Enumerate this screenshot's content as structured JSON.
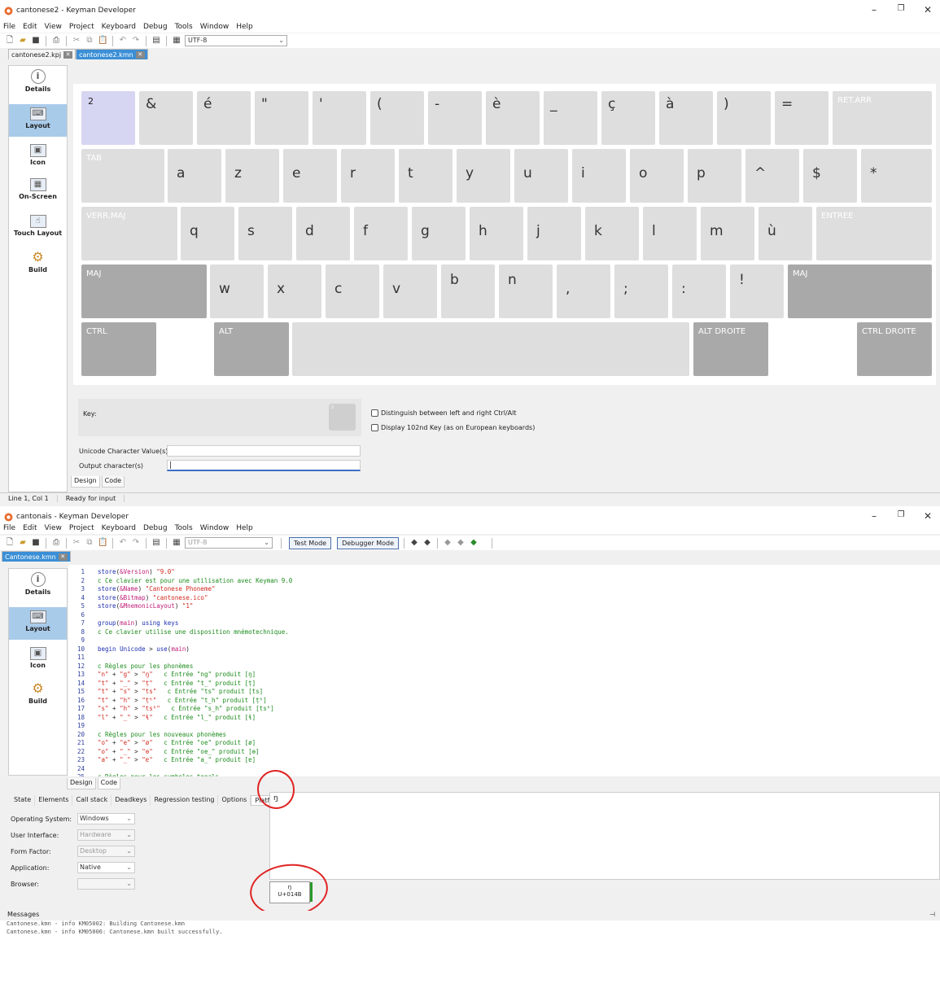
{
  "window1": {
    "title": "cantonese2 - Keyman Developer",
    "menu": [
      "File",
      "Edit",
      "View",
      "Project",
      "Keyboard",
      "Debug",
      "Tools",
      "Window",
      "Help"
    ],
    "encoding": "UTF-8",
    "tabs": [
      {
        "label": "cantonese2.kpj",
        "active": false
      },
      {
        "label": "cantonese2.kmn",
        "active": true
      }
    ],
    "sidebar": [
      {
        "label": "Details",
        "icon": "info-icon",
        "active": false
      },
      {
        "label": "Layout",
        "icon": "keyboard-icon",
        "active": true
      },
      {
        "label": "Icon",
        "icon": "image-icon",
        "active": false
      },
      {
        "label": "On-Screen",
        "icon": "screen-keyboard-icon",
        "active": false
      },
      {
        "label": "Touch Layout",
        "icon": "touch-icon",
        "active": false
      },
      {
        "label": "Build",
        "icon": "gear-icon",
        "active": false
      }
    ],
    "keyboard": {
      "row1": [
        "2",
        "&",
        "é",
        "\"",
        "'",
        "(",
        "-",
        "è",
        "_",
        "ç",
        "à",
        ")",
        "=",
        "RET.ARR"
      ],
      "row2": [
        "TAB",
        "a",
        "z",
        "e",
        "r",
        "t",
        "y",
        "u",
        "i",
        "o",
        "p",
        "^",
        "$",
        "*"
      ],
      "row3": [
        "VERR.MAJ",
        "q",
        "s",
        "d",
        "f",
        "g",
        "h",
        "j",
        "k",
        "l",
        "m",
        "ù",
        "ENTREE"
      ],
      "row4": [
        "MAJ",
        "w",
        "x",
        "c",
        "v",
        "b",
        "n",
        ",",
        ";",
        ":",
        "!",
        "MAJ"
      ],
      "row5": [
        "CTRL",
        "ALT",
        "",
        "ALT DROITE",
        "CTRL DROITE"
      ]
    },
    "key_props": {
      "key_label": "Key:",
      "key_value": "2",
      "check1": "Distinguish between left and right Ctrl/Alt",
      "check2": "Display 102nd Key (as on European keyboards)",
      "unicode_label": "Unicode Character Value(s)",
      "output_label": "Output character(s)"
    },
    "editor_tabs": [
      "Design",
      "Code"
    ],
    "status": {
      "position": "Line 1, Col 1",
      "state": "Ready for input"
    }
  },
  "window2": {
    "title": "cantonais - Keyman Developer",
    "menu": [
      "File",
      "Edit",
      "View",
      "Project",
      "Keyboard",
      "Debug",
      "Tools",
      "Window",
      "Help"
    ],
    "encoding": "UTF-8",
    "test_mode": "Test Mode",
    "debugger_mode": "Debugger Mode",
    "tabs": [
      {
        "label": "Cantonese.kmn",
        "active": true
      }
    ],
    "sidebar": [
      {
        "label": "Details",
        "icon": "info-icon",
        "active": false
      },
      {
        "label": "Layout",
        "icon": "keyboard-icon",
        "active": true
      },
      {
        "label": "Icon",
        "icon": "image-icon",
        "active": false
      },
      {
        "label": "Build",
        "icon": "gear-icon",
        "active": false
      }
    ],
    "code": [
      {
        "n": "1",
        "t": "store(&Version) \"9.0\""
      },
      {
        "n": "2",
        "t": "c Ce clavier est pour une utilisation avec Keyman 9.0"
      },
      {
        "n": "3",
        "t": "store(&Name) \"Cantonese Phoneme\""
      },
      {
        "n": "4",
        "t": "store(&Bitmap) \"cantonese.ico\""
      },
      {
        "n": "5",
        "t": "store(&MnemonicLayout) \"1\""
      },
      {
        "n": "6",
        "t": ""
      },
      {
        "n": "7",
        "t": "group(main) using keys"
      },
      {
        "n": "8",
        "t": "c Ce clavier utilise une disposition mnémotechnique."
      },
      {
        "n": "9",
        "t": ""
      },
      {
        "n": "10",
        "t": "begin Unicode > use(main)"
      },
      {
        "n": "11",
        "t": ""
      },
      {
        "n": "12",
        "t": "c Règles pour les phonèmes"
      },
      {
        "n": "13",
        "t": "\"n\" + \"g\" > \"ŋ\"   c Entrée \"ng\" produit [ŋ]"
      },
      {
        "n": "14",
        "t": "\"t\" + \"_\" > \"ṭ\"   c Entrée \"t_\" produit [ṭ]"
      },
      {
        "n": "15",
        "t": "\"t\" + \"s\" > \"ts\"   c Entrée \"ts\" produit [ts]"
      },
      {
        "n": "16",
        "t": "\"t\" + \"h\" > \"ṭʰ\"   c Entrée \"t_h\" produit [ṭʰ]"
      },
      {
        "n": "17",
        "t": "\"s\" + \"h\" > \"tsʰ\"   c Entrée \"s_h\" produit [tsʰ]"
      },
      {
        "n": "18",
        "t": "\"l\" + \"_\" > \"ɬ\"   c Entrée \"l_\" produit [ɬ]"
      },
      {
        "n": "19",
        "t": ""
      },
      {
        "n": "20",
        "t": "c Règles pour les nouveaux phonèmes"
      },
      {
        "n": "21",
        "t": "\"o\" + \"e\" > \"ø\"   c Entrée \"oe\" produit [ø]"
      },
      {
        "n": "22",
        "t": "\"o\" + \"_\" > \"ɵ\"   c Entrée \"oe_\" produit [ɵ]"
      },
      {
        "n": "23",
        "t": "\"a\" + \"_\" > \"ɐ\"   c Entrée \"a_\" produit [ɐ]"
      },
      {
        "n": "24",
        "t": ""
      },
      {
        "n": "25",
        "t": "c Règles pour les symboles tonals"
      }
    ],
    "editor_tabs": [
      "Design",
      "Code"
    ],
    "debug_tabs": [
      "State",
      "Elements",
      "Call stack",
      "Deadkeys",
      "Regression testing",
      "Options",
      "Platform"
    ],
    "debug_output": "ŋ",
    "platform": [
      {
        "label": "Operating System:",
        "value": "Windows",
        "disabled": false
      },
      {
        "label": "User Interface:",
        "value": "Hardware",
        "disabled": true
      },
      {
        "label": "Form Factor:",
        "value": "Desktop",
        "disabled": true
      },
      {
        "label": "Application:",
        "value": "Native",
        "disabled": false
      },
      {
        "label": "Browser:",
        "value": "",
        "disabled": true
      }
    ],
    "char_glyph": "ŋ",
    "char_code": "U+014B",
    "messages_title": "Messages",
    "messages": [
      "Cantonese.kmn - info KM05002: Building Cantonese.kmn",
      "Cantonese.kmn - info KM05006: Cantonese.kmn built successfully."
    ]
  },
  "colors": {
    "accent": "#3b8fd6",
    "sidebar_active": "#a9cbea",
    "annotation_red": "#e02424",
    "comment_green": "#1e8c1e",
    "string_red": "#d1281e"
  }
}
